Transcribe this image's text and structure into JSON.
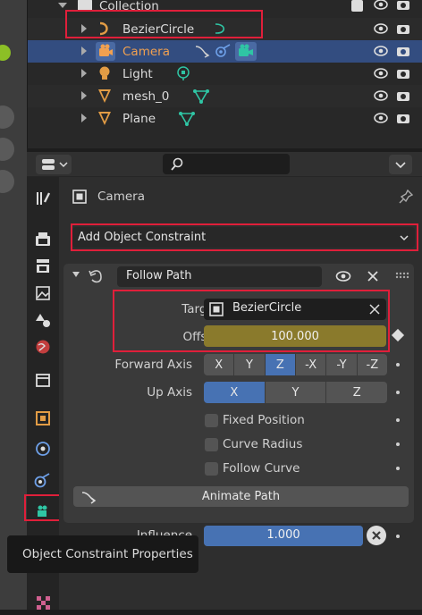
{
  "outliner": {
    "rows": [
      {
        "label": "Collection"
      },
      {
        "label": "BezierCircle"
      },
      {
        "label": "Camera"
      },
      {
        "label": "Light"
      },
      {
        "label": "mesh_0"
      },
      {
        "label": "Plane"
      }
    ]
  },
  "header": {
    "editor_type_icon": "properties-editor-icon",
    "search_placeholder": ""
  },
  "object": {
    "name": "Camera"
  },
  "add_constraint": {
    "label": "Add Object Constraint"
  },
  "constraint": {
    "name": "Follow Path",
    "target_label": "Target",
    "target_value": "BezierCircle",
    "offset_label": "Offset",
    "offset_value": "100.000",
    "forward_axis_label": "Forward Axis",
    "forward_axis_options": [
      "X",
      "Y",
      "Z",
      "-X",
      "-Y",
      "-Z"
    ],
    "forward_axis_selected": "Z",
    "up_axis_label": "Up Axis",
    "up_axis_options": [
      "X",
      "Y",
      "Z"
    ],
    "up_axis_selected": "X",
    "fixed_position_label": "Fixed Position",
    "curve_radius_label": "Curve Radius",
    "follow_curve_label": "Follow Curve",
    "animate_path_label": "Animate Path",
    "influence_label": "Influence",
    "influence_value": "1.000",
    "influence_fraction": 1.0
  },
  "tooltip": {
    "text": "Object Constraint Properties"
  },
  "colors": {
    "accent": "#4772b3",
    "offset_field": "#8a7a2c",
    "highlight": "#e01f3a",
    "selected_text": "#f0a050"
  }
}
